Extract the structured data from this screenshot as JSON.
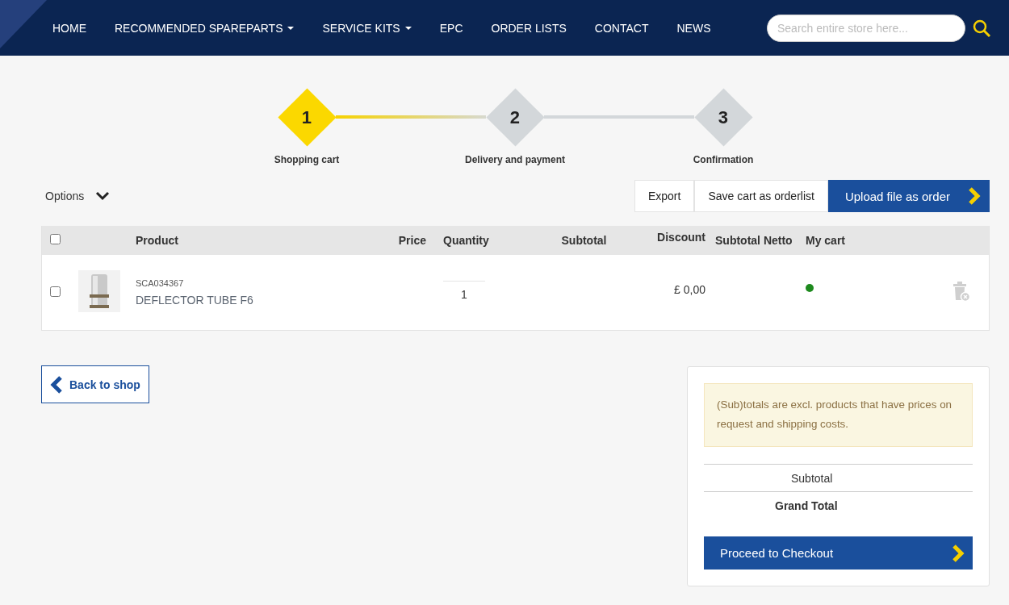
{
  "nav": [
    {
      "label": "HOME",
      "dropdown": false
    },
    {
      "label": "RECOMMENDED SPAREPARTS",
      "dropdown": true
    },
    {
      "label": "SERVICE KITS",
      "dropdown": true
    },
    {
      "label": "EPC",
      "dropdown": false
    },
    {
      "label": "ORDER LISTS",
      "dropdown": false
    },
    {
      "label": "CONTACT",
      "dropdown": false
    },
    {
      "label": "NEWS",
      "dropdown": false
    }
  ],
  "search": {
    "placeholder": "Search entire store here..."
  },
  "steps": [
    {
      "number": "1",
      "label": "Shopping cart",
      "selected": true
    },
    {
      "number": "2",
      "label": "Delivery and payment",
      "selected": false
    },
    {
      "number": "3",
      "label": "Confirmation",
      "selected": false
    }
  ],
  "options": {
    "label": "Options"
  },
  "actions": [
    {
      "label": "Export",
      "kind": "plain"
    },
    {
      "label": "Save cart as orderlist",
      "kind": "plain"
    },
    {
      "label": "Upload file as order",
      "kind": "primary"
    }
  ],
  "table": {
    "select_all": {
      "checked": false
    },
    "columns": [
      "Product",
      "Price",
      "Quantity",
      "Subtotal",
      "Discount",
      "Subtotal Netto",
      "My cart"
    ],
    "rows": [
      {
        "checked": false,
        "sku": "SCA034367",
        "name": "DEFLECTOR TUBE F6",
        "quantity": "1",
        "discount": "£ 0,00",
        "color": "#1e8a1e"
      }
    ]
  },
  "back_button": "Back to shop",
  "summary": {
    "note": "(Sub)totals are excl. products that have prices on request and shipping costs.",
    "subtotal_label": "Subtotal",
    "grand_total_label": "Grand Total",
    "checkout_button": "Proceed to Checkout"
  }
}
